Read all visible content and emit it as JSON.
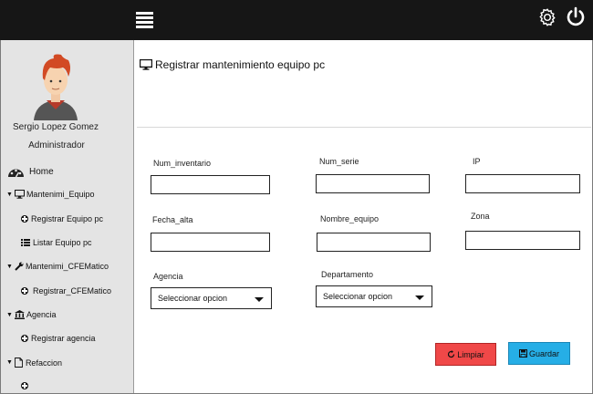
{
  "colors": {
    "topbar": "#161616",
    "sidebar": "#e4e4e4",
    "limpiar": "#f04848",
    "guardar": "#26aee6"
  },
  "topbar": {
    "menu_icon": "hamburger-icon",
    "settings_icon": "gear-icon",
    "power_icon": "power-icon"
  },
  "user": {
    "name": "Sergio Lopez  Gomez",
    "role": "Administrador"
  },
  "sidebar": {
    "home": "Home",
    "mantenimiento_equipo": "Mantenimi_Equipo",
    "registrar_equipo": "Registrar Equipo pc",
    "listar_equipo": "Listar Equipo pc",
    "mantenimiento_cfe": "Mantenimi_CFEMatico",
    "registrar_cfe": "Registrar_CFEMatico",
    "agencia": "Agencia",
    "registrar_agencia": "Registrar agencia",
    "refaccion": "Refaccion"
  },
  "page": {
    "title": "Registrar mantenimiento equipo pc"
  },
  "form": {
    "num_inventario_label": "Num_inventario",
    "num_serie_label": "Num_serie",
    "ip_label": "IP",
    "fecha_alta_label": "Fecha_alta",
    "nombre_equipo_label": "Nombre_equipo",
    "zona_label": "Zona",
    "agencia_label": "Agencia",
    "agencia_value": "Seleccionar opcion",
    "departamento_label": "Departamento",
    "departamento_value": "Seleccionar opcion"
  },
  "buttons": {
    "limpiar": "Limpiar",
    "guardar": "Guardar"
  }
}
